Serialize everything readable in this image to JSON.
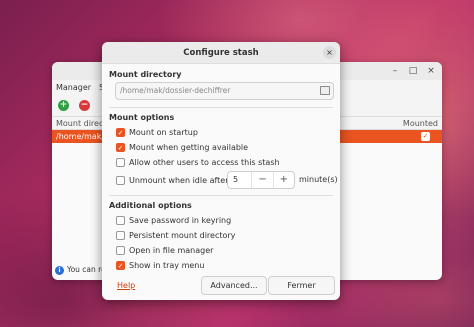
{
  "main_window": {
    "menu": [
      "Manager",
      "S"
    ],
    "columns": {
      "mount_directory": "Mount direc",
      "mounted": "Mounted"
    },
    "rows": [
      {
        "path": "/home/mak/",
        "mounted": true
      }
    ],
    "status_text": "You can re",
    "controls": {
      "minimize": "–",
      "maximize": "□",
      "close": "×"
    }
  },
  "dialog": {
    "title": "Configure stash",
    "close_glyph": "×",
    "mount_directory": {
      "title": "Mount directory",
      "value": "/home/mak/dossier-dechiffrer"
    },
    "mount_options": {
      "title": "Mount options",
      "items": [
        {
          "label": "Mount on startup",
          "checked": true
        },
        {
          "label": "Mount when getting available",
          "checked": true
        },
        {
          "label": "Allow other users to access this stash",
          "checked": false
        }
      ],
      "unmount_idle": {
        "label": "Unmount when idle after",
        "checked": false,
        "value": "5",
        "minus": "−",
        "plus": "+",
        "unit": "minute(s)"
      }
    },
    "additional_options": {
      "title": "Additional options",
      "items": [
        {
          "label": "Save password in keyring",
          "checked": false
        },
        {
          "label": "Persistent mount directory",
          "checked": false
        },
        {
          "label": "Open in file manager",
          "checked": false
        },
        {
          "label": "Show in tray menu",
          "checked": true
        }
      ]
    },
    "help": "Help",
    "buttons": {
      "advanced": "Advanced...",
      "close": "Fermer"
    }
  },
  "colors": {
    "accent": "#e95420",
    "wallpaper": "#a52a5c"
  }
}
